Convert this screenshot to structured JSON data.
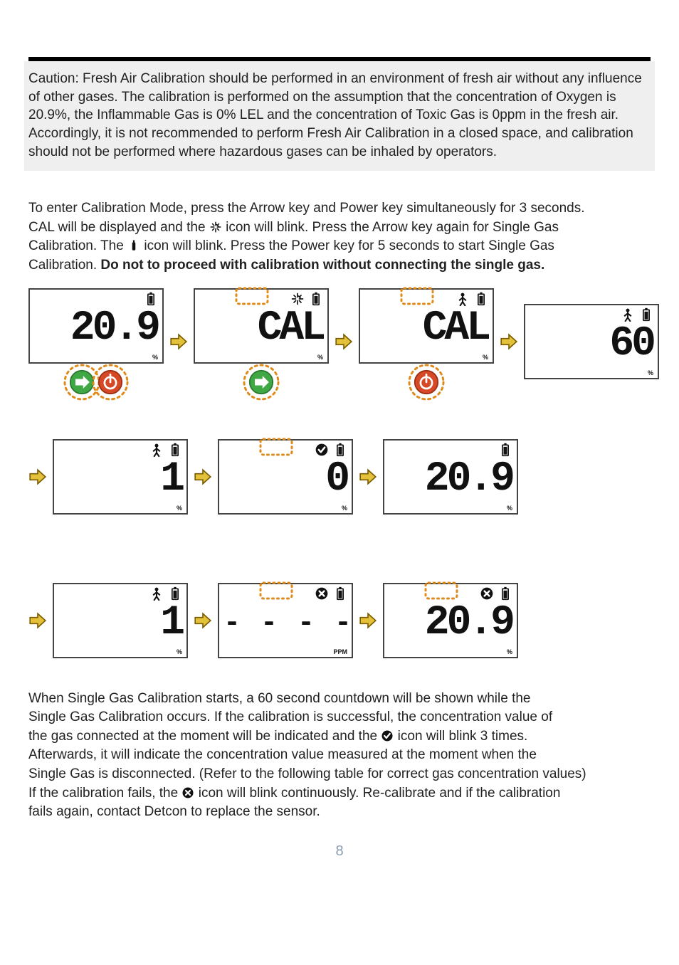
{
  "caution_text": "Caution: Fresh Air Calibration should be performed in an environment of fresh air without any influence of other gases.  The calibration is performed on the assumption that the concentration of Oxygen is 20.9%, the Inflammable Gas is 0% LEL and the concentration of Toxic Gas is 0ppm in the fresh air.  Accordingly, it is not recommended to perform Fresh Air Calibration in a closed space, and calibration should not be performed where hazardous gases can be inhaled by operators.",
  "intro": {
    "line1_pre": "To enter Calibration Mode, press the Arrow key and Power key simultaneously for 3 seconds.",
    "line2_pre": "CAL will be displayed and the ",
    "line2_post": " icon will blink.  Press the Arrow key again for Single Gas",
    "line3_pre": "Calibration.  The ",
    "line3_post": " icon will blink.  Press the Power key for 5 seconds to start Single Gas",
    "line4_pre": "Calibration.  ",
    "line4_bold": "Do not to proceed with calibration without connecting the single gas."
  },
  "icons": {
    "fresh_air": "fresh-air-icon",
    "gas_cylinder": "gas-cylinder-icon",
    "check_badge": "check-badge-icon",
    "x_badge": "x-badge-icon",
    "battery": "battery-icon",
    "person_alarm": "alarm-person-icon",
    "arrow_right": "arrow-right-icon",
    "power_button": "power-button-icon",
    "arrow_button": "arrow-button-icon"
  },
  "sequence": {
    "row1": [
      {
        "main": "20.9",
        "unit": "%",
        "icons": [
          "battery"
        ],
        "blink": null,
        "arrow_after": true
      },
      {
        "main": "CAL",
        "unit": "%",
        "icons": [
          "fresh-air",
          "battery"
        ],
        "blink": "fresh-air",
        "arrow_after": true
      },
      {
        "main": "CAL",
        "unit": "%",
        "icons": [
          "person-alarm",
          "battery"
        ],
        "blink": "person-alarm",
        "arrow_after": true
      },
      {
        "main": "60",
        "unit": "%",
        "icons": [
          "person-alarm",
          "battery"
        ],
        "blink": null,
        "arrow_after": false
      }
    ],
    "row1_buttons": [
      {
        "under_index": 0,
        "buttons": [
          "arrow",
          "power"
        ],
        "halos": [
          true,
          true
        ]
      },
      {
        "under_index": 1,
        "buttons": [
          "arrow"
        ],
        "halos": [
          true
        ]
      },
      {
        "under_index": 2,
        "buttons": [
          "power"
        ],
        "halos": [
          true
        ]
      }
    ],
    "row2": [
      {
        "leading_arrow": true,
        "main": "1",
        "unit": "%",
        "icons": [
          "person-alarm",
          "battery"
        ],
        "blink": null,
        "arrow_after": true
      },
      {
        "main": "0",
        "unit": "%",
        "icons": [
          "check-badge",
          "battery"
        ],
        "blink": "check-badge",
        "arrow_after": true
      },
      {
        "main": "20.9",
        "unit": "%",
        "icons": [
          "battery"
        ],
        "blink": null,
        "arrow_after": false
      }
    ],
    "row3": [
      {
        "leading_arrow": true,
        "main": "1",
        "unit": "%",
        "icons": [
          "person-alarm",
          "battery"
        ],
        "blink": null,
        "arrow_after": true
      },
      {
        "main": "- - - -",
        "unit": "PPM",
        "icons": [
          "x-badge",
          "battery"
        ],
        "blink": "x-badge",
        "dashes": true,
        "arrow_after": true
      },
      {
        "main": "20.9",
        "unit": "%",
        "icons": [
          "x-badge",
          "battery"
        ],
        "blink": "x-badge",
        "arrow_after": false
      }
    ]
  },
  "result": {
    "l1": "When Single Gas Calibration starts, a 60 second countdown will be shown while the",
    "l2": "Single Gas Calibration occurs.  If the calibration is successful, the concentration value of",
    "l3_pre": "the gas connected at the moment will be indicated and the ",
    "l3_post": " icon will blink 3 times.",
    "l4": "Afterwards, it will indicate the concentration value measured at the moment when the",
    "l5": "Single Gas is disconnected. (Refer to the following table for correct gas concentration values)",
    "l6_pre": "If the calibration fails, the ",
    "l6_post": " icon will blink continuously.  Re-calibrate and if the calibration",
    "l7": "fails again, contact Detcon to replace the sensor."
  },
  "page_number": "8"
}
